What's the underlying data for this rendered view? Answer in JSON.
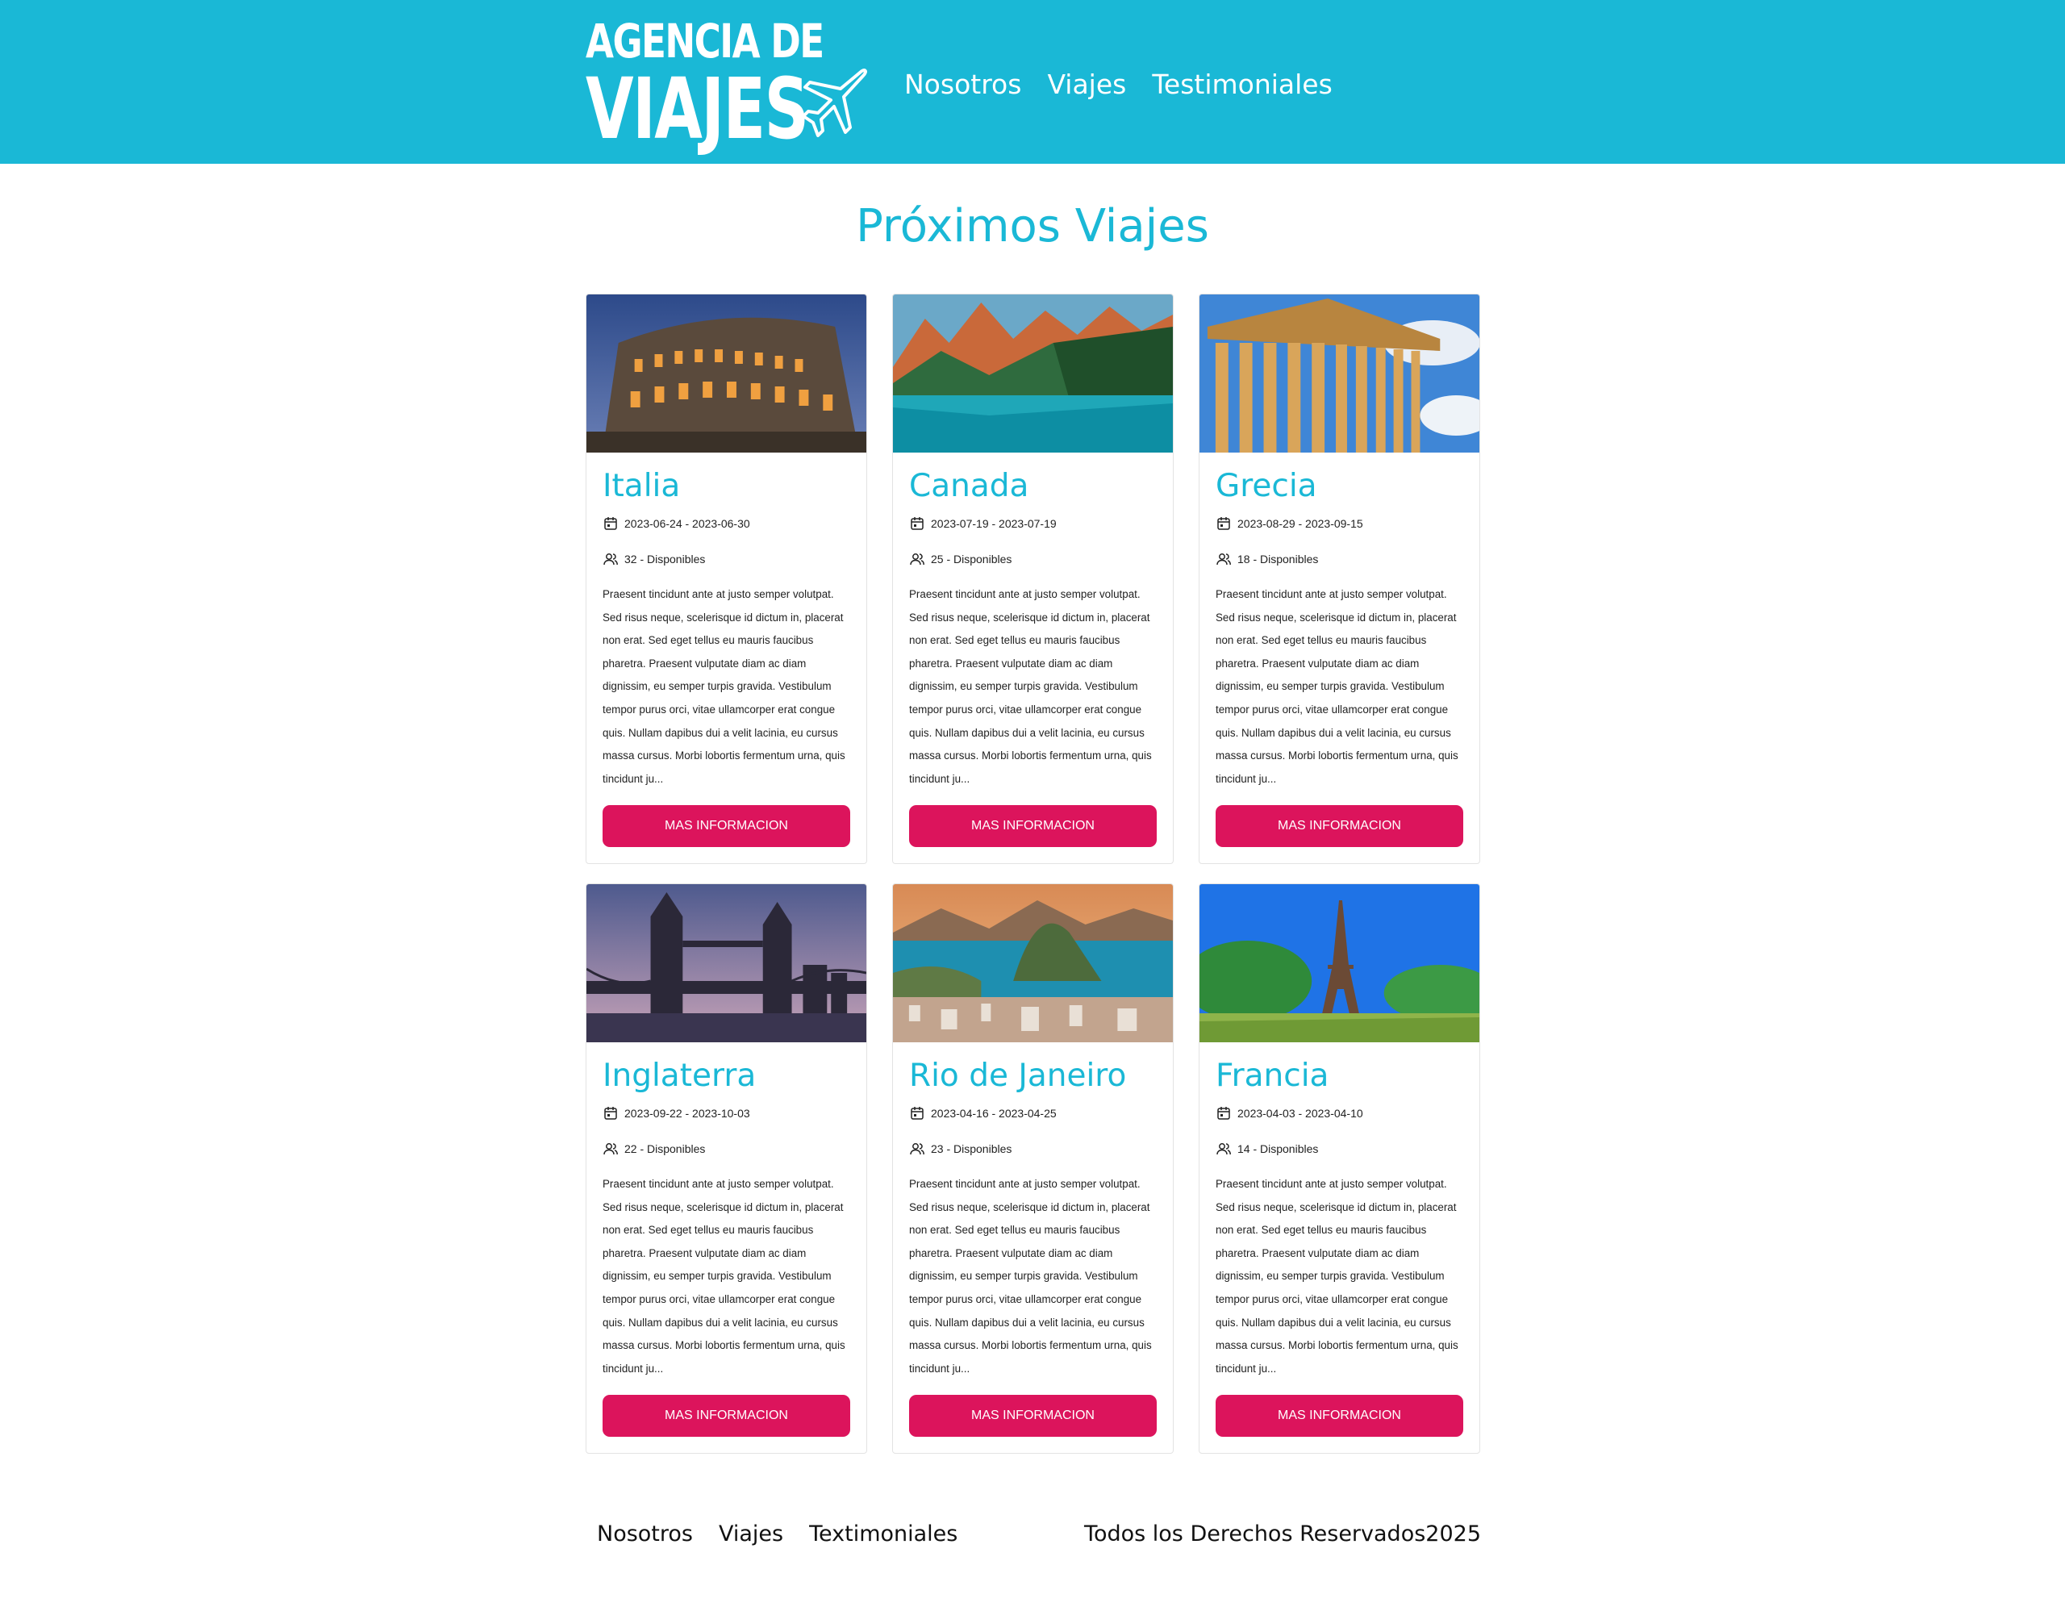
{
  "header": {
    "logo_line1": "AGENCIA DE",
    "logo_line2": "VIAJES",
    "nav": [
      "Nosotros",
      "Viajes",
      "Testimoniales"
    ]
  },
  "colors": {
    "primary": "#1ab8d6",
    "accent": "#dc145c"
  },
  "main": {
    "title": "Próximos Viajes",
    "cards": [
      {
        "title": "Italia",
        "dates": "2023-06-24 - 2023-06-30",
        "available": "32 - Disponibles",
        "description": "Praesent tincidunt ante at justo semper volutpat. Sed risus neque, scelerisque id dictum in, placerat non erat. Sed eget tellus eu mauris faucibus pharetra. Praesent vulputate diam ac diam dignissim, eu semper turpis gravida. Vestibulum tempor purus orci, vitae ullamcorper erat congue quis. Nullam dapibus dui a velit lacinia, eu cursus massa cursus. Morbi lobortis fermentum urna, quis tincidunt ju...",
        "button": "MAS INFORMACION",
        "image_icon": "colosseum-photo"
      },
      {
        "title": "Canada",
        "dates": "2023-07-19 - 2023-07-19",
        "available": "25 - Disponibles",
        "description": "Praesent tincidunt ante at justo semper volutpat. Sed risus neque, scelerisque id dictum in, placerat non erat. Sed eget tellus eu mauris faucibus pharetra. Praesent vulputate diam ac diam dignissim, eu semper turpis gravida. Vestibulum tempor purus orci, vitae ullamcorper erat congue quis. Nullam dapibus dui a velit lacinia, eu cursus massa cursus. Morbi lobortis fermentum urna, quis tincidunt ju...",
        "button": "MAS INFORMACION",
        "image_icon": "mountain-lake-photo"
      },
      {
        "title": "Grecia",
        "dates": "2023-08-29 - 2023-09-15",
        "available": "18 - Disponibles",
        "description": "Praesent tincidunt ante at justo semper volutpat. Sed risus neque, scelerisque id dictum in, placerat non erat. Sed eget tellus eu mauris faucibus pharetra. Praesent vulputate diam ac diam dignissim, eu semper turpis gravida. Vestibulum tempor purus orci, vitae ullamcorper erat congue quis. Nullam dapibus dui a velit lacinia, eu cursus massa cursus. Morbi lobortis fermentum urna, quis tincidunt ju...",
        "button": "MAS INFORMACION",
        "image_icon": "parthenon-photo"
      },
      {
        "title": "Inglaterra",
        "dates": "2023-09-22 - 2023-10-03",
        "available": "22 - Disponibles",
        "description": "Praesent tincidunt ante at justo semper volutpat. Sed risus neque, scelerisque id dictum in, placerat non erat. Sed eget tellus eu mauris faucibus pharetra. Praesent vulputate diam ac diam dignissim, eu semper turpis gravida. Vestibulum tempor purus orci, vitae ullamcorper erat congue quis. Nullam dapibus dui a velit lacinia, eu cursus massa cursus. Morbi lobortis fermentum urna, quis tincidunt ju...",
        "button": "MAS INFORMACION",
        "image_icon": "tower-bridge-photo"
      },
      {
        "title": "Rio de Janeiro",
        "dates": "2023-04-16 - 2023-04-25",
        "available": "23 - Disponibles",
        "description": "Praesent tincidunt ante at justo semper volutpat. Sed risus neque, scelerisque id dictum in, placerat non erat. Sed eget tellus eu mauris faucibus pharetra. Praesent vulputate diam ac diam dignissim, eu semper turpis gravida. Vestibulum tempor purus orci, vitae ullamcorper erat congue quis. Nullam dapibus dui a velit lacinia, eu cursus massa cursus. Morbi lobortis fermentum urna, quis tincidunt ju...",
        "button": "MAS INFORMACION",
        "image_icon": "sugarloaf-bay-photo"
      },
      {
        "title": "Francia",
        "dates": "2023-04-03 - 2023-04-10",
        "available": "14 - Disponibles",
        "description": "Praesent tincidunt ante at justo semper volutpat. Sed risus neque, scelerisque id dictum in, placerat non erat. Sed eget tellus eu mauris faucibus pharetra. Praesent vulputate diam ac diam dignissim, eu semper turpis gravida. Vestibulum tempor purus orci, vitae ullamcorper erat congue quis. Nullam dapibus dui a velit lacinia, eu cursus massa cursus. Morbi lobortis fermentum urna, quis tincidunt ju...",
        "button": "MAS INFORMACION",
        "image_icon": "eiffel-tower-photo"
      }
    ]
  },
  "footer": {
    "nav": [
      "Nosotros",
      "Viajes",
      "Textimoniales"
    ],
    "copyright": "Todos los Derechos Reservados2025"
  }
}
